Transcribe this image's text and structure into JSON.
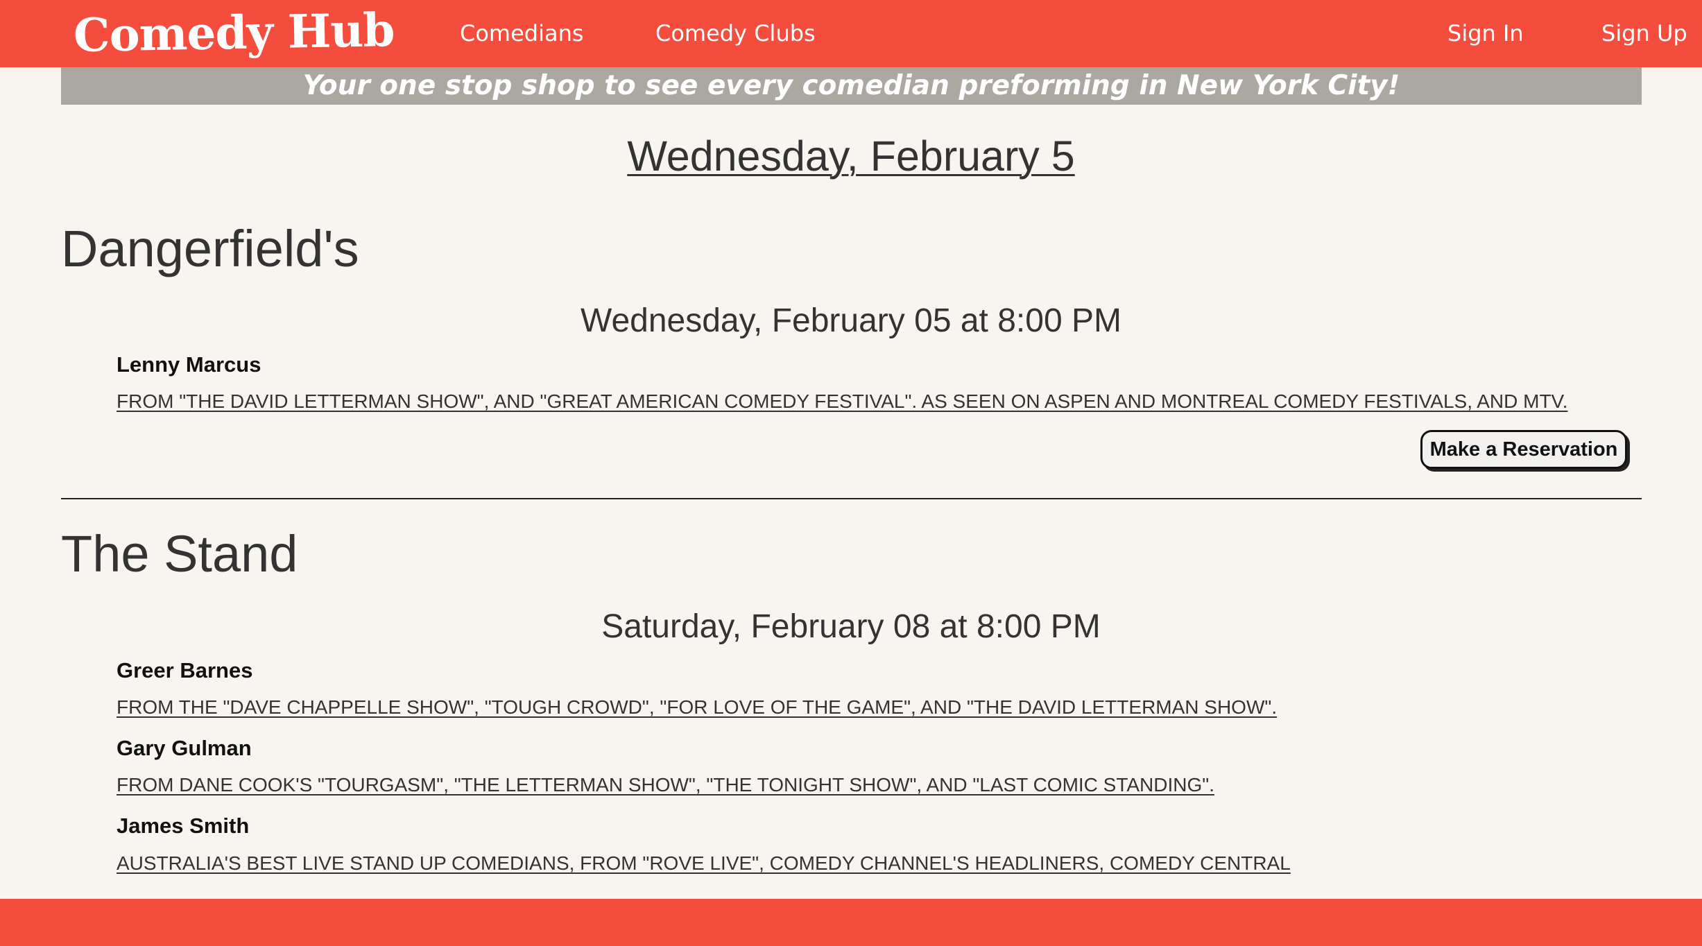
{
  "header": {
    "logo": "Comedy Hub",
    "nav": {
      "comedians": "Comedians",
      "clubs": "Comedy Clubs",
      "sign_in": "Sign In",
      "sign_up": "Sign Up"
    }
  },
  "banner": {
    "tagline": "Your one stop shop to see every comedian preforming in New York City!"
  },
  "date_heading": "Wednesday, February 5",
  "clubs": [
    {
      "name": "Dangerfield's",
      "shows": [
        {
          "time": "Wednesday, February 05 at 8:00 PM",
          "comedians": [
            {
              "name": "Lenny Marcus",
              "description": "FROM \"THE DAVID LETTERMAN SHOW\", AND \"GREAT AMERICAN COMEDY FESTIVAL\". AS SEEN ON ASPEN AND MONTREAL COMEDY FESTIVALS, AND MTV."
            }
          ],
          "reservation_label": "Make a Reservation"
        }
      ]
    },
    {
      "name": "The Stand",
      "shows": [
        {
          "time": "Saturday, February 08 at 8:00 PM",
          "comedians": [
            {
              "name": "Greer Barnes",
              "description": "FROM THE \"DAVE CHAPPELLE SHOW\", \"TOUGH CROWD\", \"FOR LOVE OF THE GAME\", AND \"THE DAVID LETTERMAN SHOW\"."
            },
            {
              "name": "Gary Gulman",
              "description": "FROM DANE COOK'S \"TOURGASM\", \"THE LETTERMAN SHOW\", \"THE TONIGHT SHOW\", AND \"LAST COMIC STANDING\"."
            },
            {
              "name": "James Smith",
              "description": "AUSTRALIA'S BEST LIVE STAND UP COMEDIANS, FROM \"ROVE LIVE\", COMEDY CHANNEL'S HEADLINERS, COMEDY CENTRAL"
            }
          ]
        }
      ]
    }
  ],
  "colors": {
    "brand": "#f44d3d",
    "banner": "#aba8a1",
    "background": "#f8f5f1",
    "text": "#333333"
  }
}
